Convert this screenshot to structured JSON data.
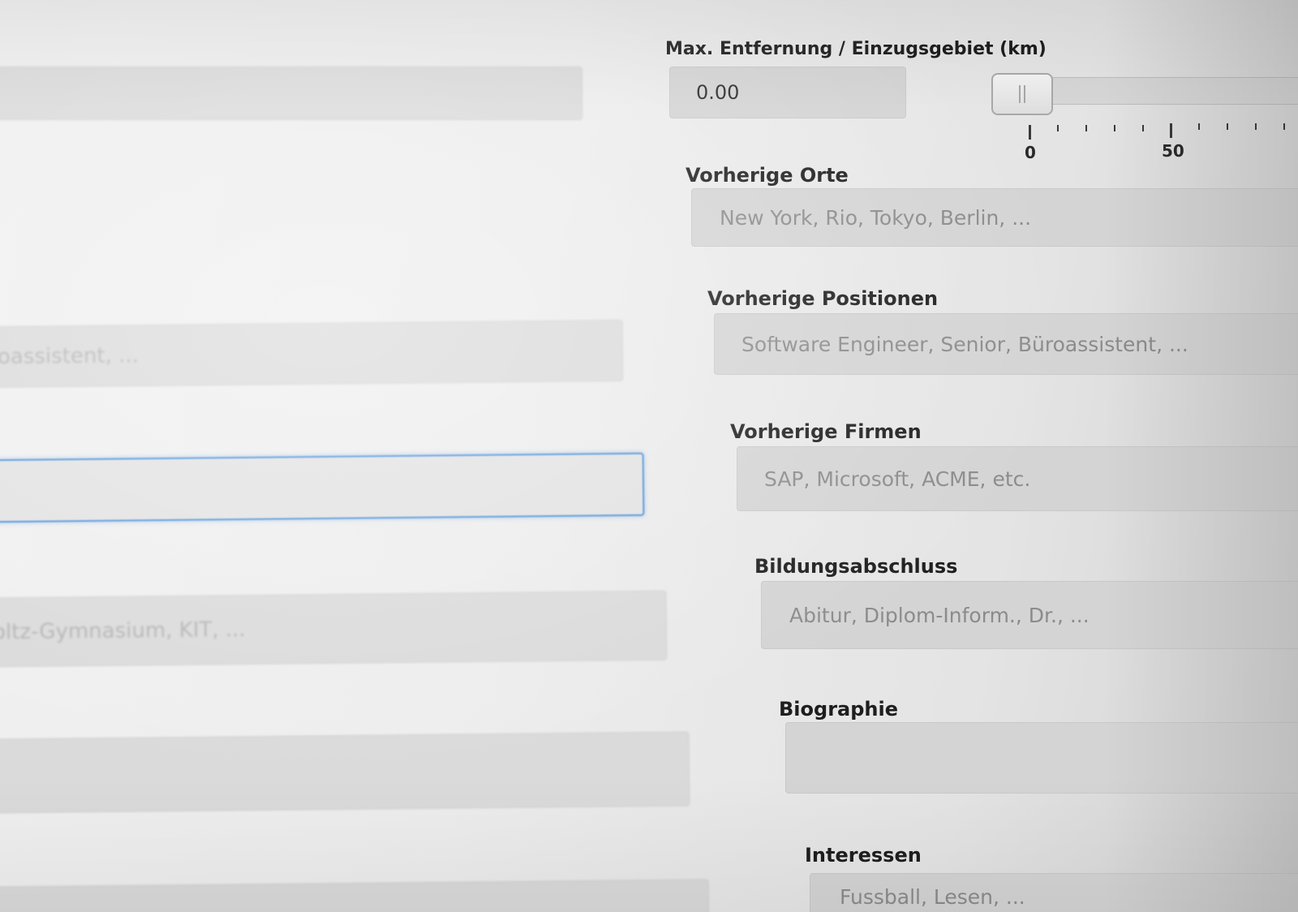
{
  "distance": {
    "label": "Max. Entfernung / Einzugsgebiet (km)",
    "value": "0.00",
    "slider": {
      "value": 0,
      "tick_labels": [
        "0",
        "50"
      ]
    }
  },
  "fields": {
    "orte": {
      "label": "Vorherige Orte",
      "placeholder": "New York, Rio, Tokyo, Berlin, ..."
    },
    "positionen": {
      "label": "Vorherige Positionen",
      "placeholder": "Software Engineer, Senior, Büroassistent, ..."
    },
    "firmen": {
      "label": "Vorherige Firmen",
      "placeholder": "SAP, Microsoft, ACME, etc."
    },
    "bildung": {
      "label": "Bildungsabschluss",
      "placeholder": "Abitur, Diplom-Inform., Dr., ..."
    },
    "biographie": {
      "label": "Biographie",
      "placeholder": ""
    },
    "interessen": {
      "label": "Interessen",
      "placeholder": "Fussball, Lesen, ..."
    }
  },
  "left_column": {
    "field_1": {
      "text": ""
    },
    "field_2": {
      "text": "oassistent, ..."
    },
    "field_3": {
      "text": ""
    },
    "field_4": {
      "text": "oltz-Gymnasium, KIT, ..."
    },
    "field_5": {
      "text": ""
    },
    "field_6": {
      "text": ""
    }
  }
}
